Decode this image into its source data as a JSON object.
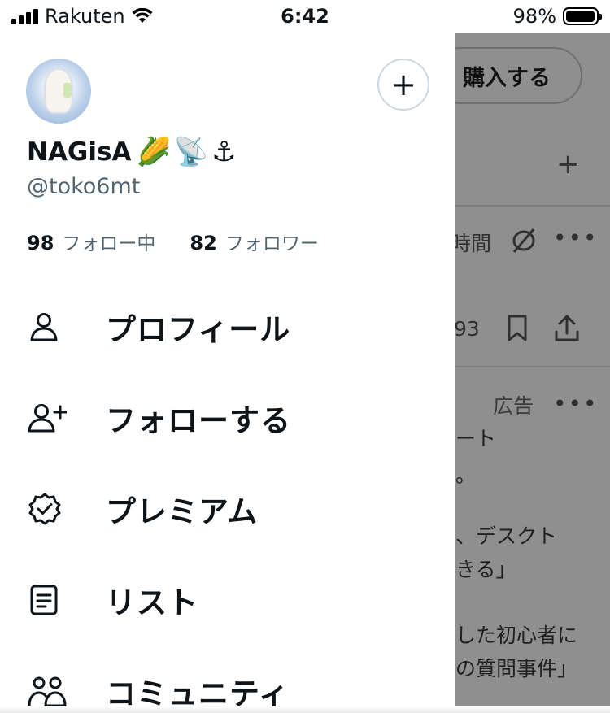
{
  "status_bar": {
    "carrier": "Rakuten",
    "time": "6:42",
    "battery_percent": "98%",
    "battery_level": 0.98
  },
  "background": {
    "buy_button": "購入する",
    "time_fragment": "時間",
    "count_fragment": "93",
    "ad_label": "広告",
    "text_lines": [
      "ート",
      "。",
      "、デスクト",
      "きる」",
      "した初心者に",
      "の質問事件」"
    ]
  },
  "drawer": {
    "display_name": "NAGisA",
    "name_emojis": [
      "🌽",
      "📡",
      "⚓"
    ],
    "handle": "@toko6mt",
    "following_count": "98",
    "following_label": "フォロー中",
    "followers_count": "82",
    "followers_label": "フォロワー",
    "add_account_symbol": "+",
    "menu": [
      {
        "label": "プロフィール",
        "icon": "person-icon"
      },
      {
        "label": "フォローする",
        "icon": "person-add-icon"
      },
      {
        "label": "プレミアム",
        "icon": "verified-badge-icon"
      },
      {
        "label": "リスト",
        "icon": "list-icon"
      },
      {
        "label": "コミュニティ",
        "icon": "communities-icon"
      }
    ]
  }
}
